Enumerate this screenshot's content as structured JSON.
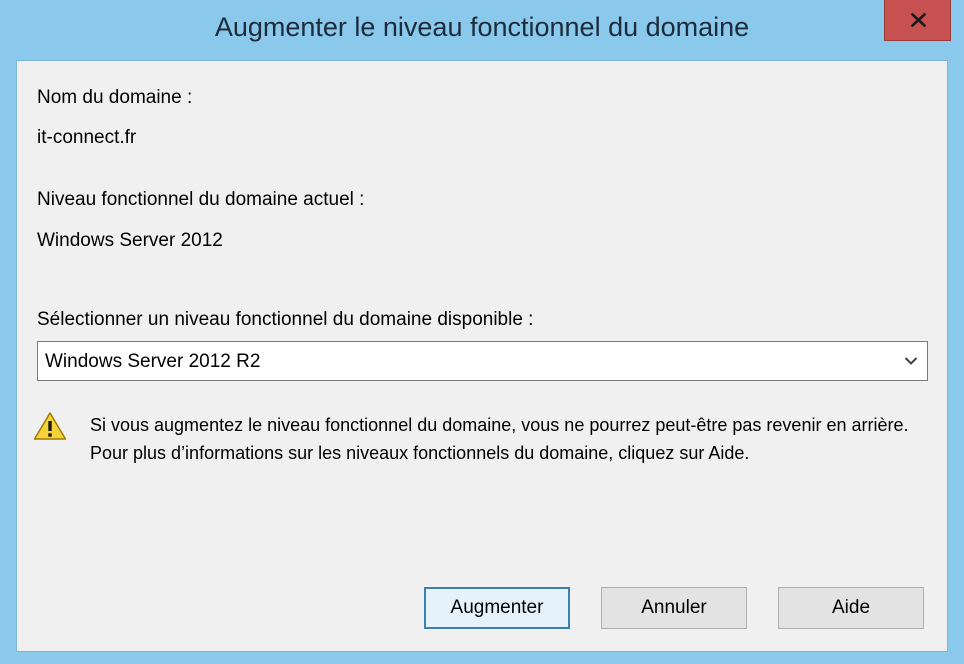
{
  "window": {
    "title": "Augmenter le niveau fonctionnel du domaine"
  },
  "domain": {
    "name_label": "Nom du domaine :",
    "name_value": "it-connect.fr",
    "current_level_label": "Niveau fonctionnel du domaine actuel :",
    "current_level_value": "Windows Server 2012"
  },
  "select": {
    "label": "Sélectionner un niveau fonctionnel du domaine disponible :",
    "selected": "Windows Server 2012 R2"
  },
  "warning": {
    "text": "Si vous augmentez le niveau fonctionnel du domaine, vous ne pourrez peut-être pas revenir en arrière. Pour plus d’informations sur les niveaux fonctionnels du domaine, cliquez sur Aide."
  },
  "buttons": {
    "raise": "Augmenter",
    "cancel": "Annuler",
    "help": "Aide"
  },
  "icons": {
    "close": "close-icon",
    "dropdown": "chevron-down-icon",
    "warning": "warning-icon"
  },
  "colors": {
    "frame": "#8ac9ec",
    "close_button": "#c75050",
    "client_background": "#f0f0f0",
    "warning_yellow": "#f5d33b"
  }
}
